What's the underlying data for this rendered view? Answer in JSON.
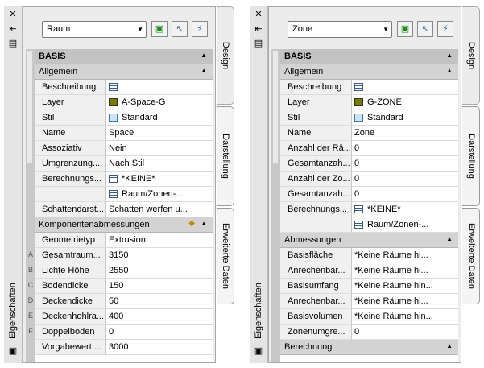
{
  "panels": [
    {
      "title": "Eigenschaften",
      "combo": "Raum",
      "tabs": {
        "design": "Design",
        "darstellung": "Darstellung",
        "erweitert": "Erweiterte Daten"
      },
      "basis": "BASIS",
      "allgemein": "Allgemein",
      "rows": [
        {
          "label": "Beschreibung",
          "value": "",
          "icon": "doc"
        },
        {
          "label": "Layer",
          "value": "A-Space-G",
          "icon": "layer"
        },
        {
          "label": "Stil",
          "value": "Standard",
          "icon": "style"
        },
        {
          "label": "Name",
          "value": "Space",
          "icon": ""
        },
        {
          "label": "Assoziativ",
          "value": "Nein",
          "icon": ""
        },
        {
          "label": "Umgrenzung...",
          "value": "Nach Stil",
          "icon": ""
        },
        {
          "label": "Berechnungs...",
          "value": "*KEINE*",
          "icon": "doc"
        },
        {
          "label": "",
          "value": "Raum/Zonen-...",
          "icon": "doc"
        },
        {
          "label": "Schattendarst...",
          "value": "Schatten werfen u...",
          "icon": ""
        }
      ],
      "section2": "Komponentenabmessungen",
      "rows2": [
        {
          "letter": "",
          "label": "Geometrietyp",
          "value": "Extrusion"
        },
        {
          "letter": "A",
          "label": "Gesamtraum...",
          "value": "3150"
        },
        {
          "letter": "B",
          "label": "Lichte Höhe",
          "value": "2550"
        },
        {
          "letter": "C",
          "label": "Bodendicke",
          "value": "150"
        },
        {
          "letter": "D",
          "label": "Deckendicke",
          "value": "50"
        },
        {
          "letter": "E",
          "label": "Deckenhohlra...",
          "value": "400"
        },
        {
          "letter": "F",
          "label": "Doppelboden",
          "value": "0"
        },
        {
          "letter": "",
          "label": "Vorgabewert ...",
          "value": "3000"
        }
      ]
    },
    {
      "title": "Eigenschaften",
      "combo": "Zone",
      "tabs": {
        "design": "Design",
        "darstellung": "Darstellung",
        "erweitert": "Erweiterte Daten"
      },
      "basis": "BASIS",
      "allgemein": "Allgemein",
      "rows": [
        {
          "label": "Beschreibung",
          "value": "",
          "icon": "doc"
        },
        {
          "label": "Layer",
          "value": "G-ZONE",
          "icon": "layer"
        },
        {
          "label": "Stil",
          "value": "Standard",
          "icon": "style"
        },
        {
          "label": "Name",
          "value": "Zone",
          "icon": ""
        },
        {
          "label": "Anzahl der Rä...",
          "value": "0",
          "icon": ""
        },
        {
          "label": "Gesamtanzah...",
          "value": "0",
          "icon": ""
        },
        {
          "label": "Anzahl der Zo...",
          "value": "0",
          "icon": ""
        },
        {
          "label": "Gesamtanzah...",
          "value": "0",
          "icon": ""
        },
        {
          "label": "Berechnungs...",
          "value": "*KEINE*",
          "icon": "doc"
        },
        {
          "label": "",
          "value": "Raum/Zonen-...",
          "icon": "doc"
        }
      ],
      "section2": "Abmessungen",
      "rows2": [
        {
          "letter": "",
          "label": "Basisfläche",
          "value": "*Keine Räume hi..."
        },
        {
          "letter": "",
          "label": "Anrechenbar...",
          "value": "*Keine Räume hi..."
        },
        {
          "letter": "",
          "label": "Basisumfang",
          "value": "*Keine Räume hin..."
        },
        {
          "letter": "",
          "label": "Anrechenbar...",
          "value": "*Keine Räume hi..."
        },
        {
          "letter": "",
          "label": "Basisvolumen",
          "value": "*Keine Räume hin..."
        },
        {
          "letter": "",
          "label": "Zonenumgre...",
          "value": "0"
        }
      ],
      "section3": "Berechnung"
    }
  ]
}
